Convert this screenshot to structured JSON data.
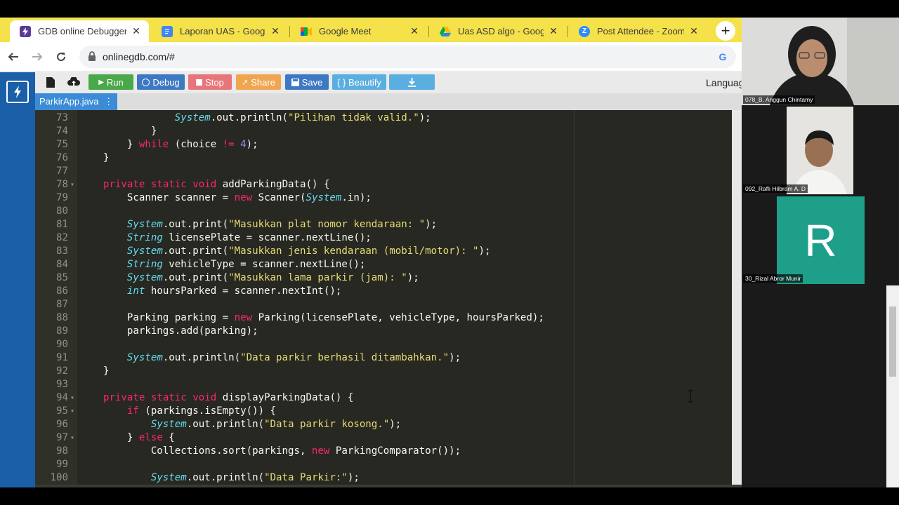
{
  "browser": {
    "tabs": [
      {
        "title": "GDB online Debugger | c",
        "icon": "gdb-favicon",
        "active": true
      },
      {
        "title": "Laporan UAS - Google D",
        "icon": "google-docs-icon",
        "active": false
      },
      {
        "title": "Google Meet",
        "icon": "google-meet-icon",
        "active": false
      },
      {
        "title": "Uas ASD algo - Google D",
        "icon": "google-drive-icon",
        "active": false
      },
      {
        "title": "Post Attendee - Zoom",
        "icon": "zoom-icon",
        "active": false
      }
    ],
    "new_tab_label": "+",
    "close_glyph": "✕",
    "url": "onlinegdb.com/#",
    "colors": {
      "tabbar": "#f5e14a",
      "active_tab": "#ffffff"
    }
  },
  "gdb": {
    "toolbar": {
      "run": "Run",
      "debug": "Debug",
      "stop": "Stop",
      "share": "Share",
      "save": "Save",
      "beautify": "{ } Beautify",
      "language_label": "Languag"
    },
    "file_tab": "ParkirApp.java",
    "colors": {
      "run": "#4aa84a",
      "debug": "#3d78c2",
      "stop": "#e8757a",
      "share": "#f0a550",
      "save": "#3d78c2",
      "beautify": "#5aaee0",
      "download": "#5aaee0",
      "sidebar": "#1b5fa8"
    }
  },
  "editor": {
    "lines": [
      {
        "n": "73",
        "fold": false,
        "code": "                System.out.println(\"Pilihan tidak valid.\");"
      },
      {
        "n": "74",
        "fold": false,
        "code": "            }"
      },
      {
        "n": "75",
        "fold": false,
        "code": "        } while (choice != 4);"
      },
      {
        "n": "76",
        "fold": false,
        "code": "    }"
      },
      {
        "n": "77",
        "fold": false,
        "code": ""
      },
      {
        "n": "78",
        "fold": true,
        "code": "    private static void addParkingData() {"
      },
      {
        "n": "79",
        "fold": false,
        "code": "        Scanner scanner = new Scanner(System.in);"
      },
      {
        "n": "80",
        "fold": false,
        "code": ""
      },
      {
        "n": "81",
        "fold": false,
        "code": "        System.out.print(\"Masukkan plat nomor kendaraan: \");"
      },
      {
        "n": "82",
        "fold": false,
        "code": "        String licensePlate = scanner.nextLine();"
      },
      {
        "n": "83",
        "fold": false,
        "code": "        System.out.print(\"Masukkan jenis kendaraan (mobil/motor): \");"
      },
      {
        "n": "84",
        "fold": false,
        "code": "        String vehicleType = scanner.nextLine();"
      },
      {
        "n": "85",
        "fold": false,
        "code": "        System.out.print(\"Masukkan lama parkir (jam): \");"
      },
      {
        "n": "86",
        "fold": false,
        "code": "        int hoursParked = scanner.nextInt();"
      },
      {
        "n": "87",
        "fold": false,
        "code": ""
      },
      {
        "n": "88",
        "fold": false,
        "code": "        Parking parking = new Parking(licensePlate, vehicleType, hoursParked);"
      },
      {
        "n": "89",
        "fold": false,
        "code": "        parkings.add(parking);"
      },
      {
        "n": "90",
        "fold": false,
        "code": ""
      },
      {
        "n": "91",
        "fold": false,
        "code": "        System.out.println(\"Data parkir berhasil ditambahkan.\");"
      },
      {
        "n": "92",
        "fold": false,
        "code": "    }"
      },
      {
        "n": "93",
        "fold": false,
        "code": ""
      },
      {
        "n": "94",
        "fold": true,
        "code": "    private static void displayParkingData() {"
      },
      {
        "n": "95",
        "fold": true,
        "code": "        if (parkings.isEmpty()) {"
      },
      {
        "n": "96",
        "fold": false,
        "code": "            System.out.println(\"Data parkir kosong.\");"
      },
      {
        "n": "97",
        "fold": true,
        "code": "        } else {"
      },
      {
        "n": "98",
        "fold": false,
        "code": "            Collections.sort(parkings, new ParkingComparator());"
      },
      {
        "n": "99",
        "fold": false,
        "code": ""
      },
      {
        "n": "100",
        "fold": false,
        "code": "            System.out.println(\"Data Parkir:\");"
      }
    ],
    "colors": {
      "background": "#272822",
      "keyword": "#f92672",
      "type": "#66d9ef",
      "string": "#e6db74",
      "number": "#ae81ff"
    }
  },
  "zoom": {
    "participants": [
      {
        "name": "078_B. Anggun Chintamy",
        "kind": "video"
      },
      {
        "name": "092_Rafli Hilbram A. D",
        "kind": "video"
      },
      {
        "name": "30_Rizal Abror Munir",
        "kind": "avatar",
        "initial": "R",
        "color": "#1d9f8a"
      }
    ]
  }
}
